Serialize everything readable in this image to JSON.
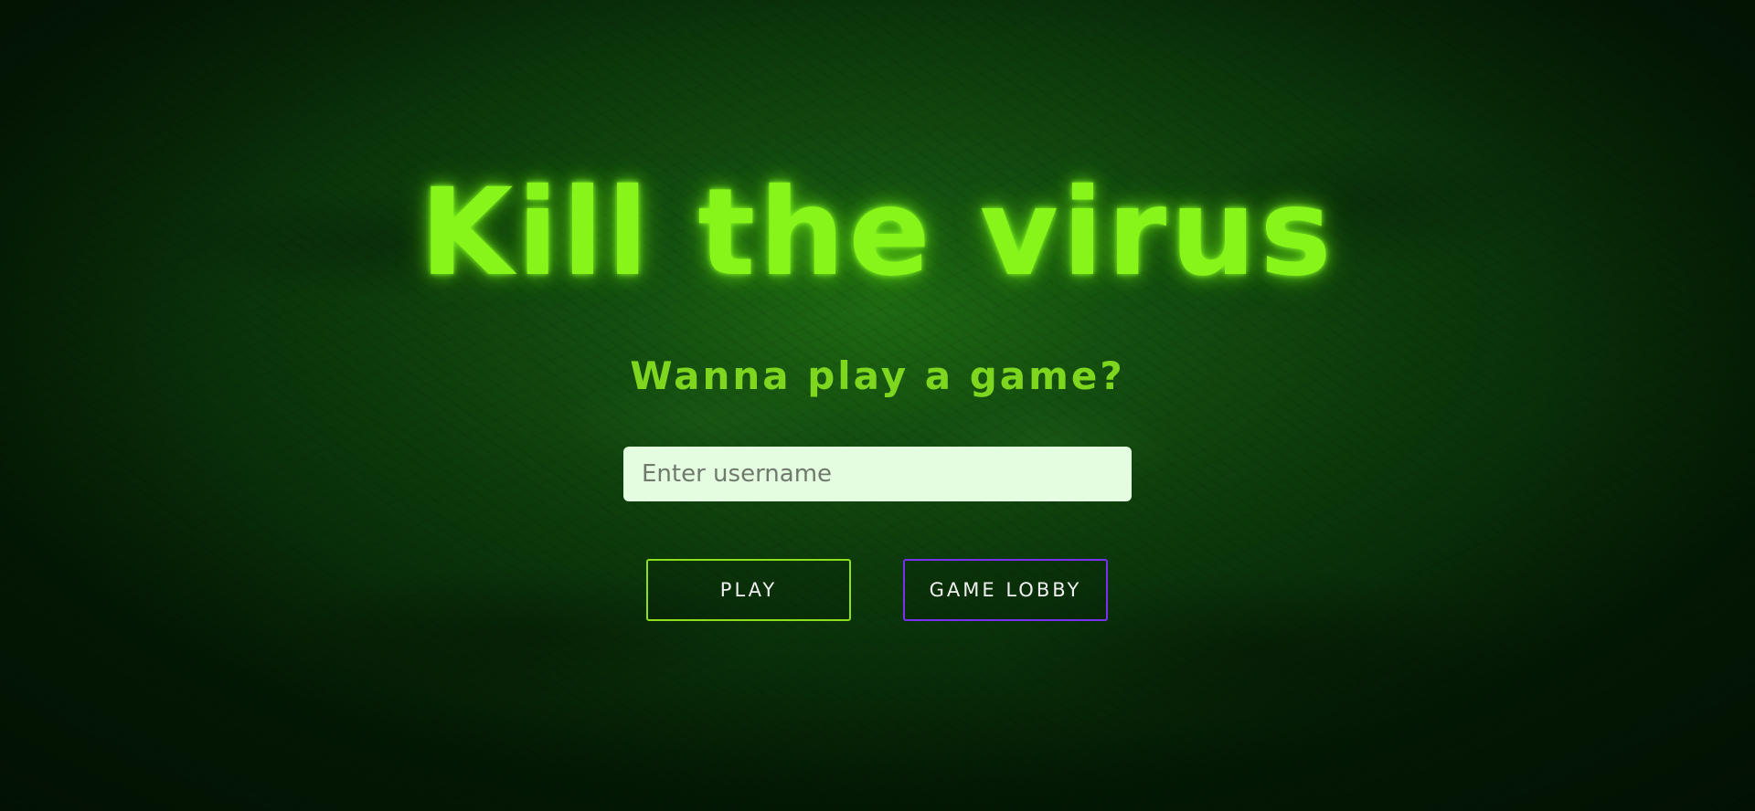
{
  "page": {
    "title": "Kill the virus",
    "subtitle": "Wanna play a game?"
  },
  "form": {
    "username_placeholder": "Enter username",
    "username_value": ""
  },
  "buttons": {
    "play_label": "PLAY",
    "lobby_label": "GAME LOBBY"
  },
  "colors": {
    "title": "#88f51a",
    "subtitle": "#7fd61e",
    "play_border": "#8ee01c",
    "lobby_border": "#7b2ff0",
    "input_background": "#e4fde0"
  }
}
